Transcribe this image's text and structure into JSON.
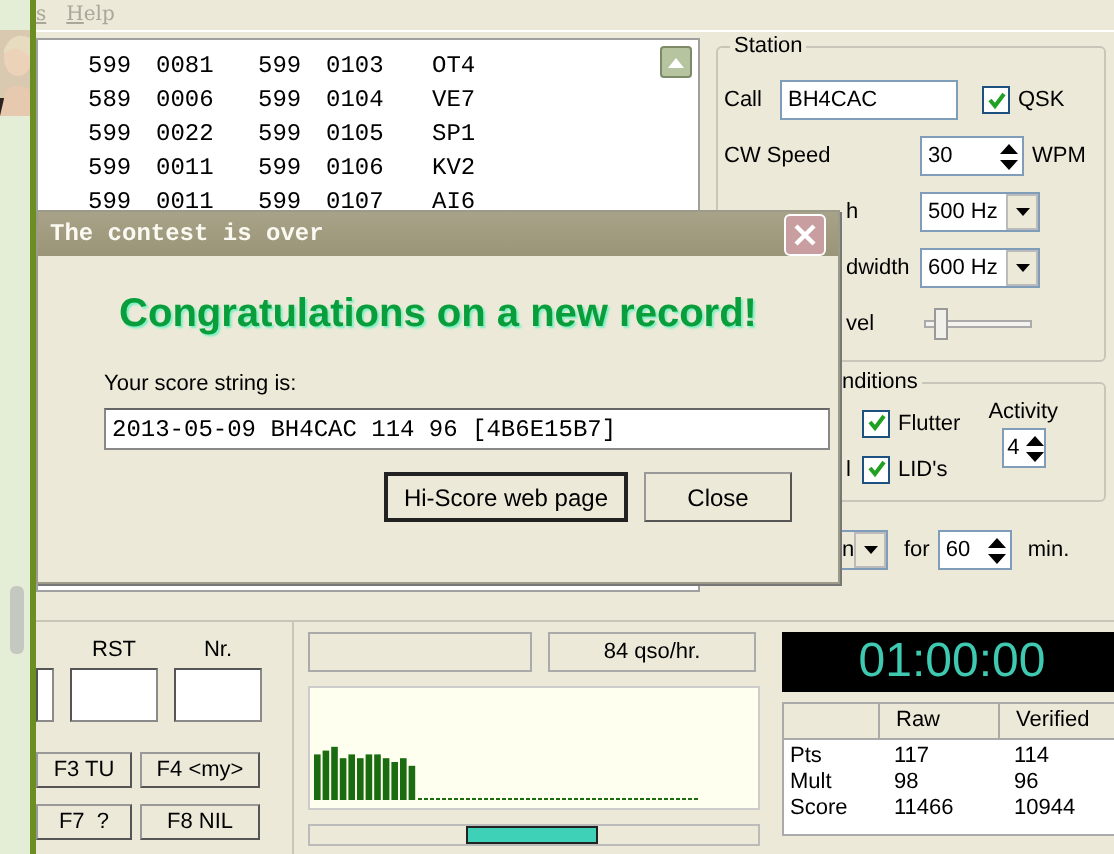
{
  "menu": [
    {
      "label": "s"
    },
    {
      "label": "Help"
    }
  ],
  "log": {
    "rows": [
      [
        "599",
        "0081",
        "599",
        "0103",
        "OT4"
      ],
      [
        "589",
        "0006",
        "599",
        "0104",
        "VE7"
      ],
      [
        "599",
        "0022",
        "599",
        "0105",
        "SP1"
      ],
      [
        "599",
        "0011",
        "599",
        "0106",
        "KV2"
      ],
      [
        "599",
        "0011",
        "599",
        "0107",
        "AI6"
      ]
    ]
  },
  "station": {
    "title": "Station",
    "call_label": "Call",
    "call": "BH4CAC",
    "qsk": {
      "label": "QSK",
      "checked": true
    },
    "speed_label": "CW Speed",
    "speed": "30",
    "speed_unit": "WPM",
    "pitch_label": "h",
    "pitch": "500 Hz",
    "bandwidth_label": "dwidth",
    "bandwidth": "600 Hz",
    "level_label": "vel",
    "level": 0.1
  },
  "conditions": {
    "title": "nditions",
    "label": "l",
    "flutter": {
      "label": "Flutter",
      "checked": true
    },
    "lids": {
      "label": "LID's",
      "checked": true
    },
    "activity_label": "Activity",
    "activity": "4"
  },
  "run": {
    "mode": "n",
    "for_label": "for",
    "minutes": "60",
    "unit": "min."
  },
  "entry": {
    "rst_label": "RST",
    "nr_label": "Nr.",
    "buttons": [
      "F3 TU",
      "F4 <my>",
      "F7  ?",
      "F8 NIL"
    ]
  },
  "rate": "84 qso/hr.",
  "clock": "01:00:00",
  "score": {
    "columns": [
      "Raw",
      "Verified"
    ],
    "rows": [
      {
        "label": "Pts",
        "raw": "117",
        "verified": "114"
      },
      {
        "label": "Mult",
        "raw": "98",
        "verified": "96"
      },
      {
        "label": "Score",
        "raw": "11466",
        "verified": "10944"
      }
    ]
  },
  "dialog": {
    "title": "The contest is over",
    "headline": "Congratulations on a new record!",
    "prompt": "Your score string is:",
    "score_string": "2013-05-09 BH4CAC 114 96 [4B6E15B7]",
    "buttons": [
      {
        "label": "Hi-Score web page",
        "default": true
      },
      {
        "label": "Close",
        "default": false
      }
    ]
  }
}
